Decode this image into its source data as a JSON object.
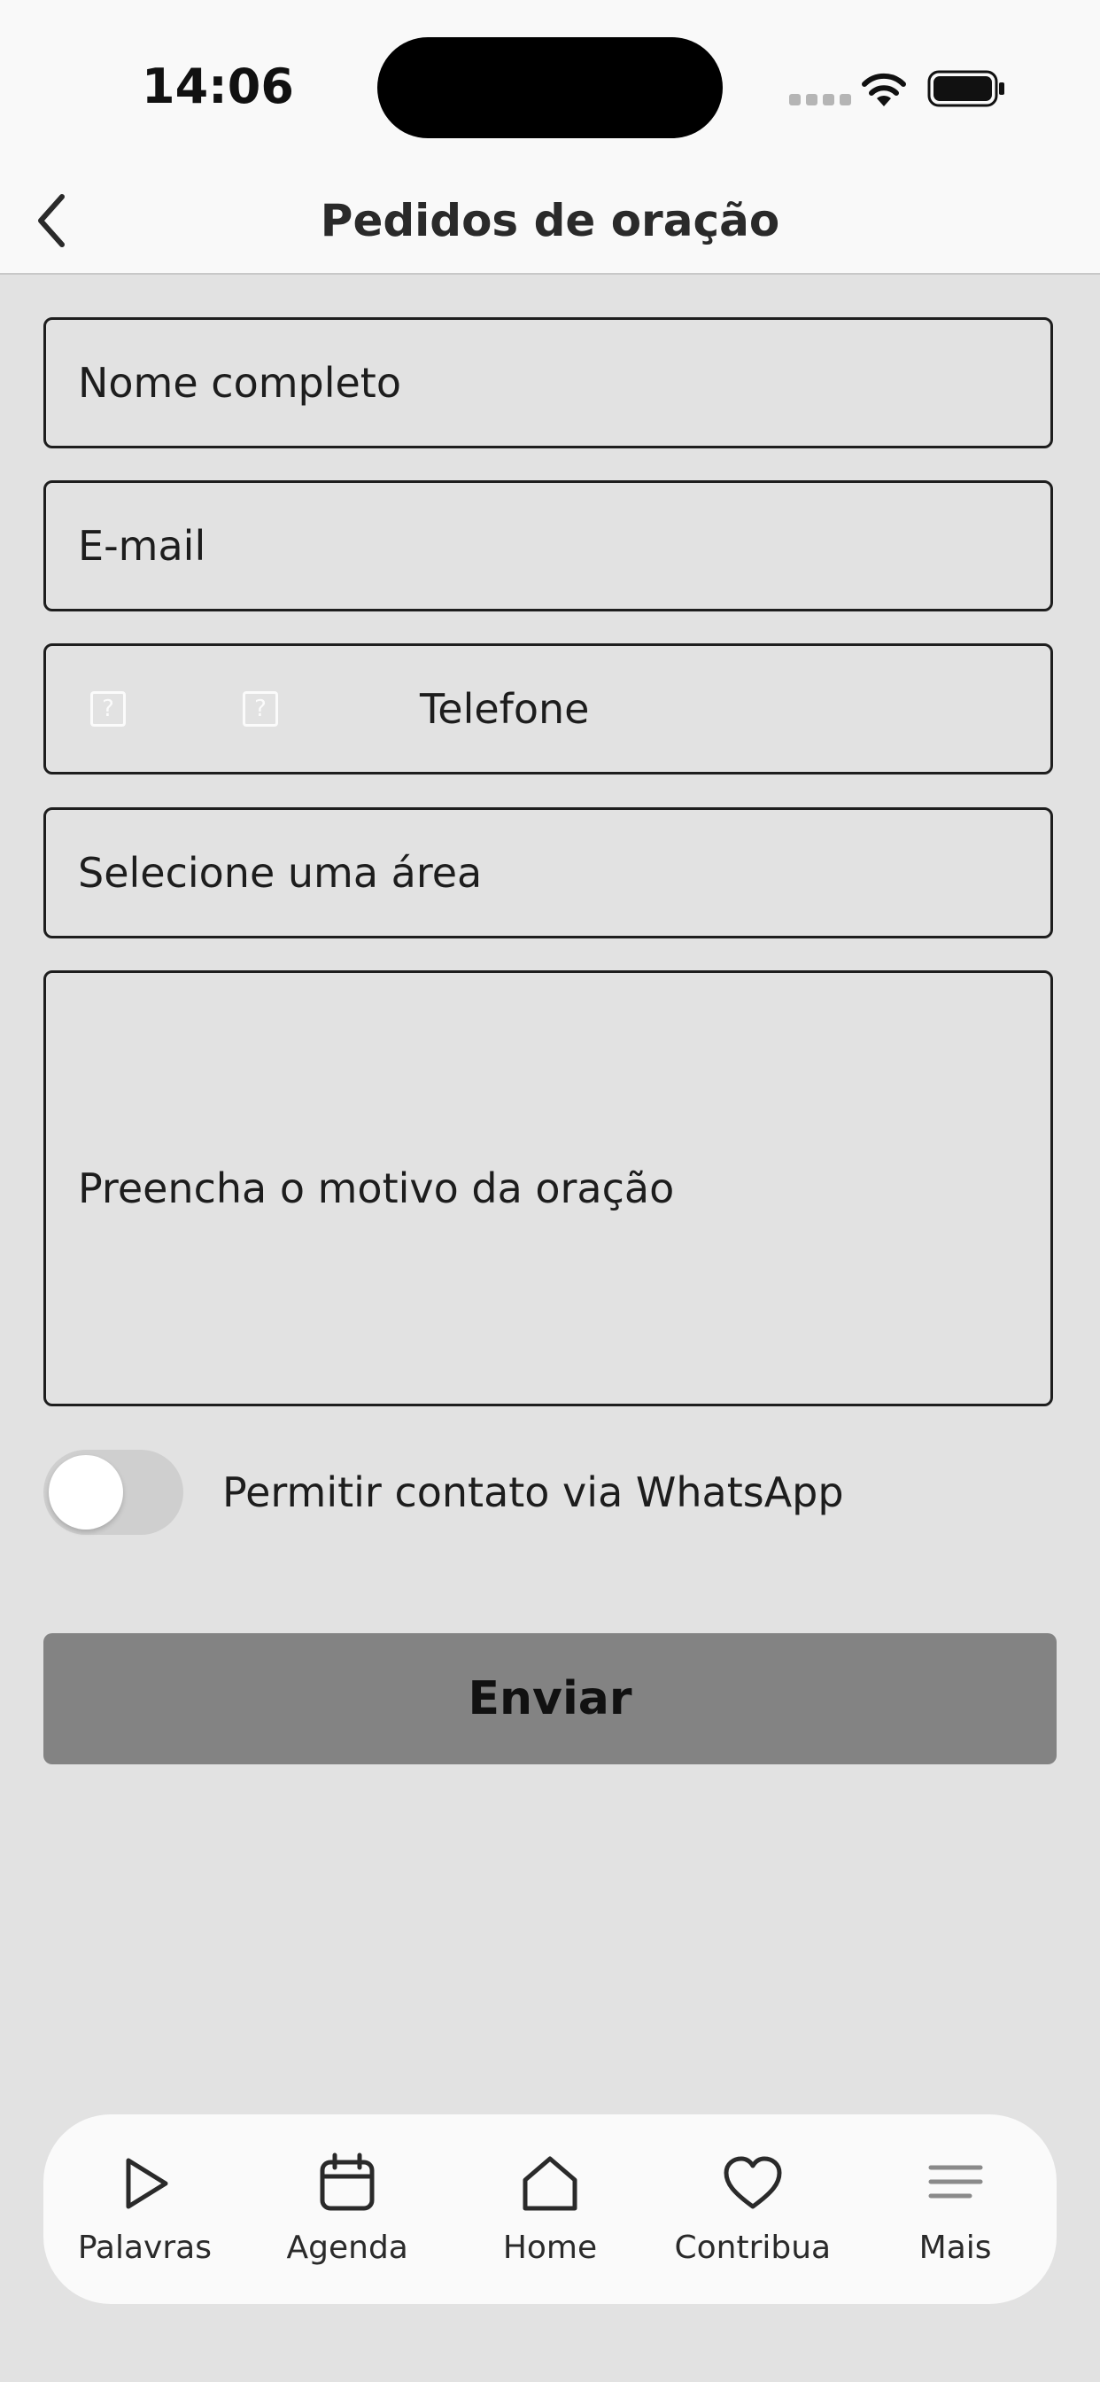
{
  "status_bar": {
    "time": "14:06"
  },
  "nav": {
    "title": "Pedidos de oração",
    "back_icon": "chevron-left-icon"
  },
  "form": {
    "name_placeholder": "Nome completo",
    "email_placeholder": "E-mail",
    "phone_placeholder": "Telefone",
    "phone_icon_glyph": "?",
    "area_placeholder": "Selecione uma área",
    "reason_placeholder": "Preencha o motivo da oração",
    "whatsapp_label": "Permitir contato via WhatsApp",
    "whatsapp_enabled": false,
    "submit_label": "Enviar"
  },
  "tabs": [
    {
      "label": "Palavras",
      "icon": "play-icon"
    },
    {
      "label": "Agenda",
      "icon": "calendar-icon"
    },
    {
      "label": "Home",
      "icon": "home-icon"
    },
    {
      "label": "Contribua",
      "icon": "heart-icon"
    },
    {
      "label": "Mais",
      "icon": "menu-icon"
    }
  ],
  "colors": {
    "background": "#e2e2e2",
    "bar_background": "#f9f9f9",
    "button_background": "#838383",
    "border": "#1e1e1e"
  }
}
